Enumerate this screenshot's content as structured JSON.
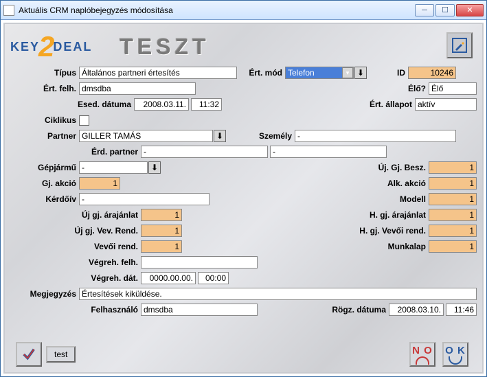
{
  "window": {
    "title": "Aktuális CRM naplóbejegyzés módosítása"
  },
  "header": {
    "logo_left": "KEY",
    "logo_right": "DEAL",
    "banner": "TESZT"
  },
  "labels": {
    "tipus": "Típus",
    "ert_mod": "Ért. mód",
    "id": "ID",
    "ert_felh": "Ért. felh.",
    "elo": "Élő?",
    "esed_datuma": "Esed. dátuma",
    "ert_allapot": "Ért. állapot",
    "ciklikus": "Ciklikus",
    "partner": "Partner",
    "szemely": "Személy",
    "erd_partner": "Érd. partner",
    "gepjarmu": "Gépjármű",
    "uj_gj_besz": "Új. Gj. Besz.",
    "gj_akcio": "Gj. akció",
    "alk_akcio": "Alk. akció",
    "kerdoiv": "Kérdőív",
    "modell": "Modell",
    "uj_gj_arajanlat": "Új gj. árajánlat",
    "h_gj_arajanlat": "H. gj. árajánlat",
    "uj_gj_vev_rend": "Új gj. Vev. Rend.",
    "h_gj_vevoi_rend": "H. gj. Vevői rend.",
    "vevoi_rend": "Vevői rend.",
    "munkalap": "Munkalap",
    "vegreh_felh": "Végreh. felh.",
    "vegreh_dat": "Végreh. dát.",
    "megjegyzes": "Megjegyzés",
    "felhasznalo": "Felhasználó",
    "rogz_datuma": "Rögz. dátuma"
  },
  "values": {
    "tipus": "Általános partneri értesítés",
    "ert_mod": "Telefon",
    "id": "10246",
    "ert_felh": "dmsdba",
    "elo": "Élő",
    "esed_date": "2008.03.11.",
    "esed_time": "11:32",
    "ert_allapot": "aktív",
    "partner": "GILLER TAMÁS",
    "szemely": "-",
    "erd_partner1": "-",
    "erd_partner2": "-",
    "gepjarmu": "-",
    "uj_gj_besz": "1",
    "gj_akcio": "1",
    "alk_akcio": "1",
    "kerdoiv": "-",
    "modell": "1",
    "uj_gj_arajanlat": "1",
    "h_gj_arajanlat": "1",
    "uj_gj_vev_rend": "1",
    "h_gj_vevoi_rend": "1",
    "vevoi_rend": "1",
    "munkalap": "1",
    "vegreh_felh": "",
    "vegreh_date": "0000.00.00.",
    "vegreh_time": "00:00",
    "megjegyzes": "Értesítések kiküldése.",
    "felhasznalo": "dmsdba",
    "rogz_date": "2008.03.10.",
    "rogz_time": "11:46"
  },
  "buttons": {
    "test": "test",
    "no": "N O",
    "ok": "O K"
  }
}
